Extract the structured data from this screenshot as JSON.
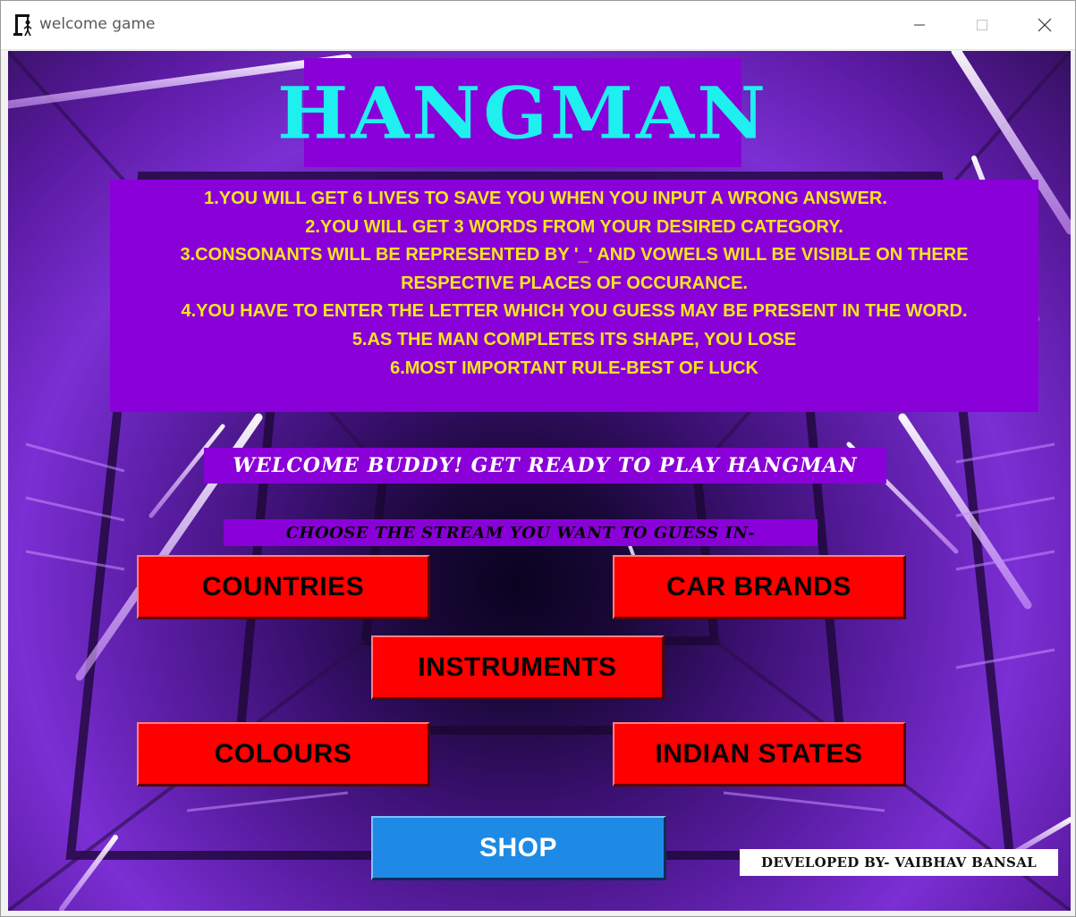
{
  "window": {
    "title": "welcome game",
    "app_icon": "hangman-gallows-icon",
    "controls": [
      "minimize-icon",
      "maximize-icon",
      "close-icon"
    ]
  },
  "game": {
    "title": "HANGMAN",
    "rules": [
      "1.YOU WILL GET 6 LIVES TO SAVE YOU WHEN YOU INPUT A WRONG ANSWER.",
      "2.YOU WILL GET 3 WORDS FROM YOUR DESIRED CATEGORY.",
      "3.CONSONANTS WILL BE REPRESENTED BY '_' AND VOWELS WILL BE VISIBLE ON THERE",
      "RESPECTIVE PLACES OF OCCURANCE.",
      "4.YOU HAVE TO ENTER THE LETTER WHICH YOU GUESS MAY BE PRESENT IN THE WORD.",
      "5.AS THE MAN COMPLETES ITS SHAPE, YOU LOSE",
      "6.MOST IMPORTANT RULE-BEST OF LUCK"
    ],
    "welcome": "WELCOME BUDDY! GET READY TO PLAY HANGMAN",
    "choose_prompt": "CHOOSE THE STREAM YOU WANT TO GUESS IN-",
    "categories": {
      "countries": "COUNTRIES",
      "car_brands": "CAR BRANDS",
      "instruments": "INSTRUMENTS",
      "colours": "COLOURS",
      "indian_states": "INDIAN STATES"
    },
    "shop": "SHOP",
    "credit": "DEVELOPED BY- VAIBHAV BANSAL"
  },
  "colors": {
    "panel_purple": "#8a00d8",
    "title_cyan": "#1ef0f0",
    "rules_yellow": "#f5e61c",
    "category_red": "#ff0000",
    "shop_blue": "#1e8ae6"
  }
}
